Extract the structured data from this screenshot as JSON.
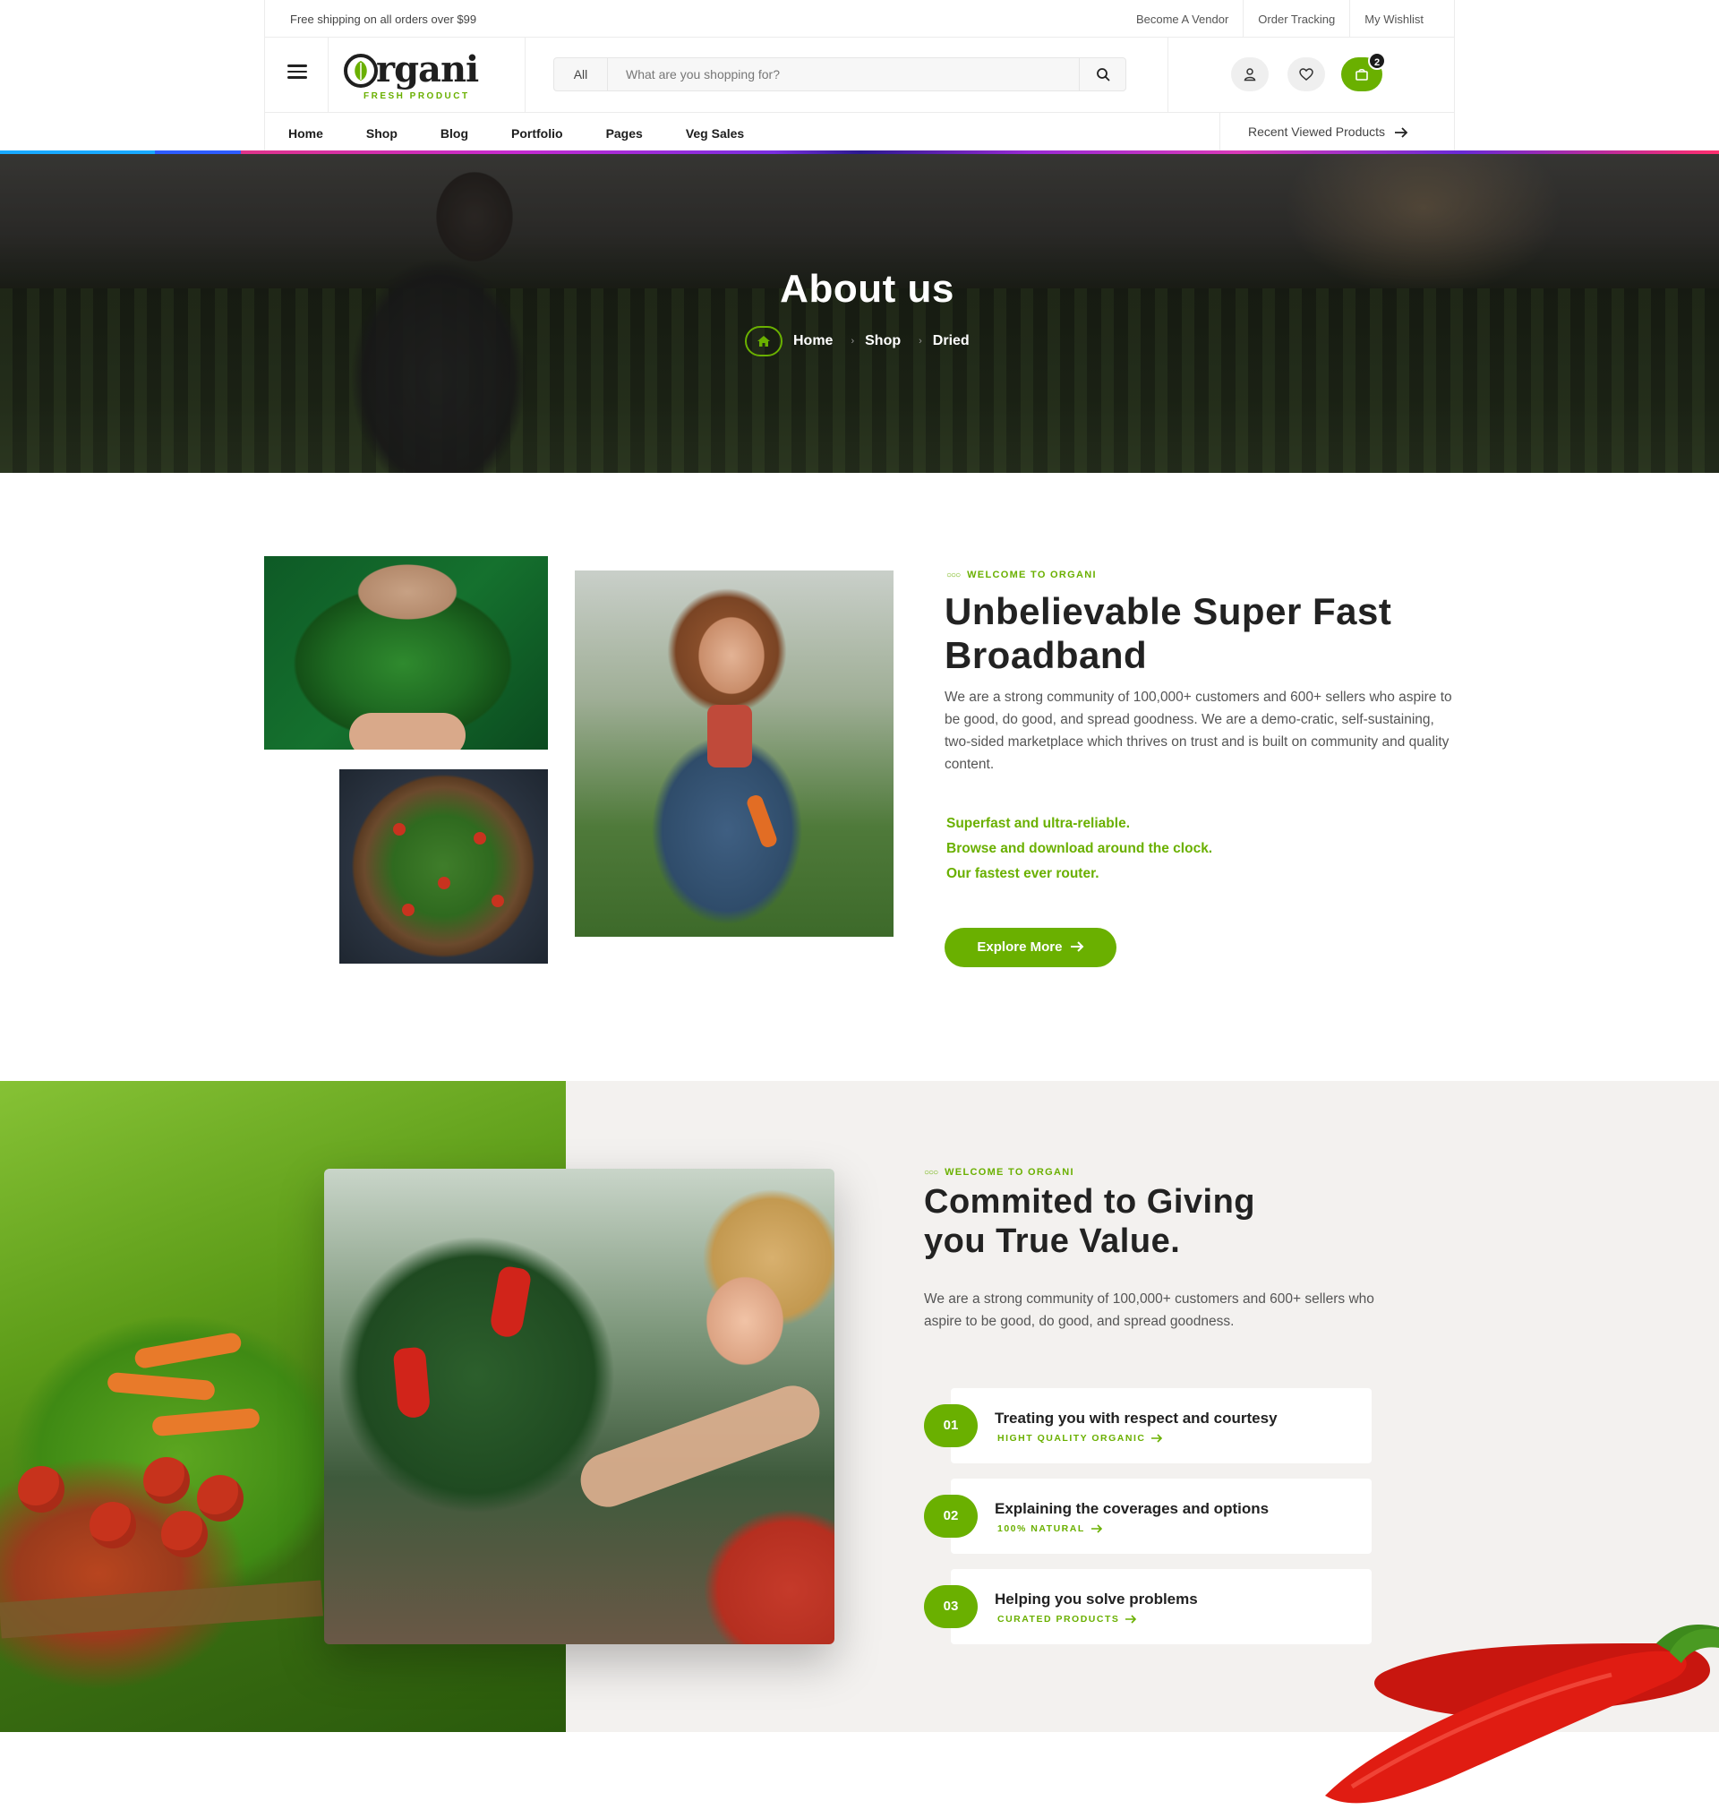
{
  "topbar": {
    "promo": "Free shipping on all orders over $99",
    "links": [
      "Become A Vendor",
      "Order Tracking",
      "My Wishlist"
    ]
  },
  "header": {
    "logo_word": "rgani",
    "logo_tagline": "FRESH PRODUCT",
    "search": {
      "category": "All",
      "placeholder": "What are you shopping for?"
    },
    "cart_count": "2"
  },
  "nav": {
    "items": [
      "Home",
      "Shop",
      "Blog",
      "Portfolio",
      "Pages",
      "Veg Sales"
    ],
    "recent": "Recent Viewed Products"
  },
  "hero": {
    "title": "About us",
    "breadcrumb": [
      "Home",
      "Shop",
      "Dried"
    ]
  },
  "about": {
    "eyebrow": "WELCOME TO ORGANI",
    "title_line1": "Unbelievable Super Fast",
    "title_line2": "Broadband",
    "paragraph": "We are a strong community of 100,000+ customers and 600+ sellers who aspire to be good, do good, and spread goodness. We are a demo-cratic, self-sustaining, two-sided marketplace which thrives on trust and is built on community and quality content.",
    "features": [
      "Superfast and ultra-reliable.",
      "Browse and download around the clock.",
      "Our fastest ever router."
    ],
    "button": "Explore More"
  },
  "committed": {
    "eyebrow": "WELCOME TO ORGANI",
    "title_line1": "Commited to Giving",
    "title_line2": "you True Value.",
    "paragraph": "We are a strong community of 100,000+ customers and 600+ sellers who aspire to be good, do good, and spread goodness.",
    "cards": [
      {
        "num": "01",
        "title": "Treating you with respect and courtesy",
        "sub": "HIGHT QUALITY ORGANIC"
      },
      {
        "num": "02",
        "title": "Explaining the coverages and options",
        "sub": "100% NATURAL"
      },
      {
        "num": "03",
        "title": "Helping you solve problems",
        "sub": "CURATED PRODUCTS"
      }
    ]
  },
  "colors": {
    "accent": "#6ab000",
    "dark": "#222222",
    "section_bg": "#f3f1ef"
  }
}
